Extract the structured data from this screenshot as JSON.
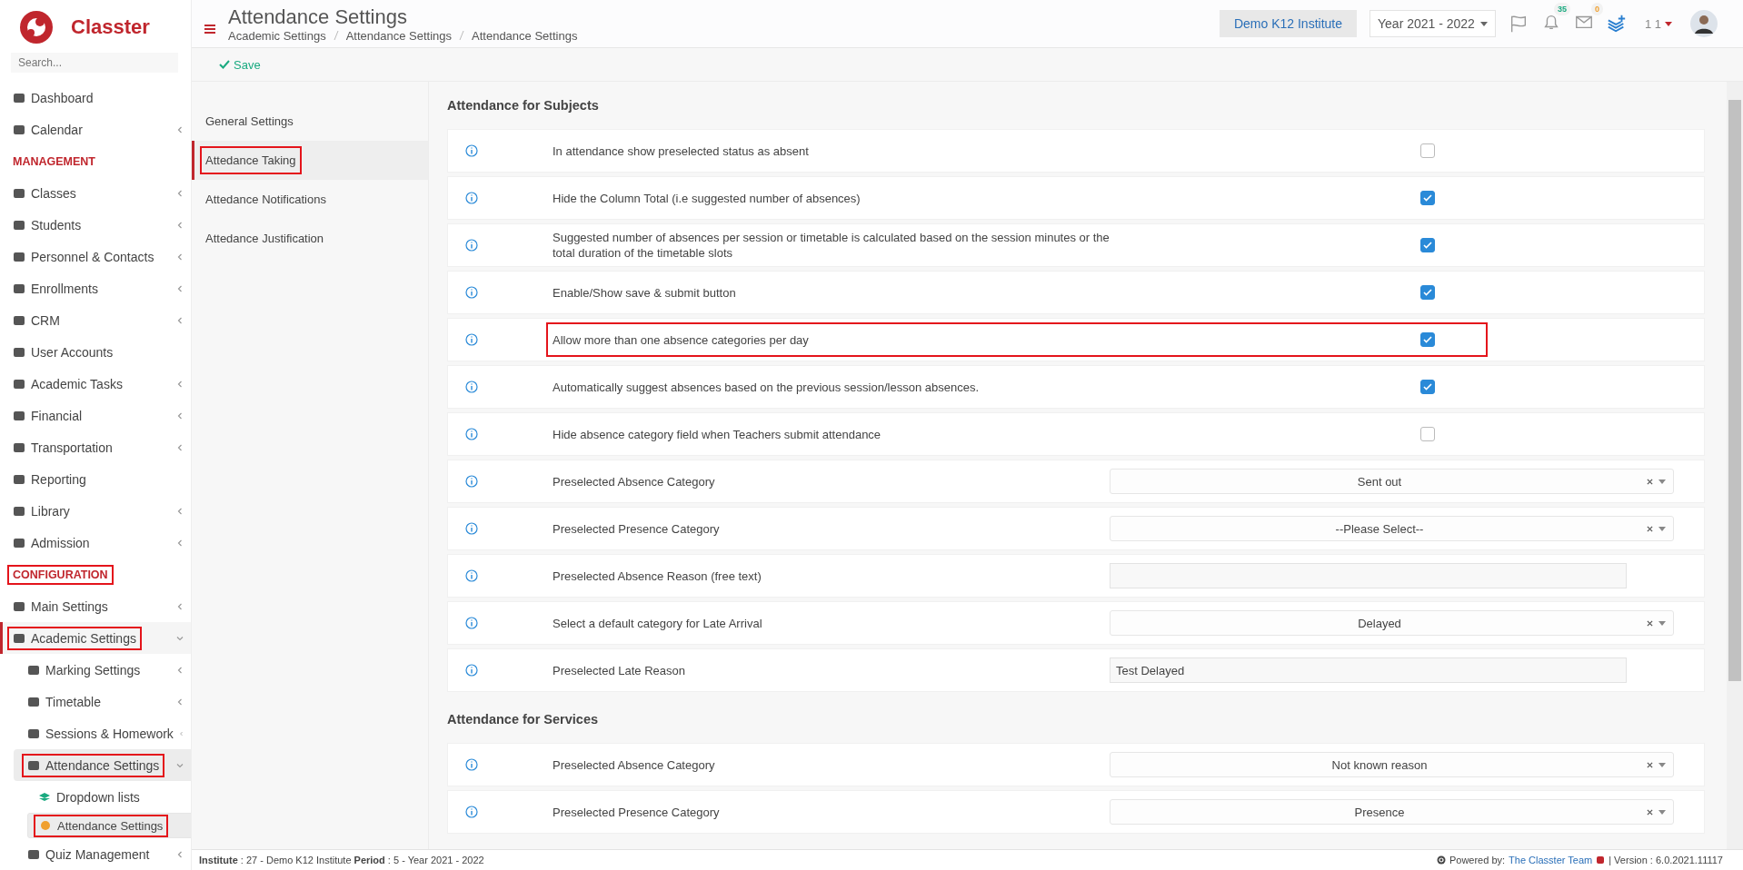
{
  "sidebar": {
    "brand": "Classter",
    "search_placeholder": "Search...",
    "items": [
      {
        "kind": "item",
        "label": "Dashboard",
        "has_children": false,
        "expanded": false,
        "selected": false,
        "highlighted": false
      },
      {
        "kind": "item",
        "label": "Calendar",
        "has_children": true,
        "expanded": false,
        "selected": false,
        "highlighted": false
      },
      {
        "kind": "heading",
        "label": "MANAGEMENT",
        "highlighted": false
      },
      {
        "kind": "item",
        "label": "Classes",
        "has_children": true,
        "expanded": false,
        "selected": false,
        "highlighted": false
      },
      {
        "kind": "item",
        "label": "Students",
        "has_children": true,
        "expanded": false,
        "selected": false,
        "highlighted": false
      },
      {
        "kind": "item",
        "label": "Personnel & Contacts",
        "has_children": true,
        "expanded": false,
        "selected": false,
        "highlighted": false
      },
      {
        "kind": "item",
        "label": "Enrollments",
        "has_children": true,
        "expanded": false,
        "selected": false,
        "highlighted": false
      },
      {
        "kind": "item",
        "label": "CRM",
        "has_children": true,
        "expanded": false,
        "selected": false,
        "highlighted": false
      },
      {
        "kind": "item",
        "label": "User Accounts",
        "has_children": false,
        "expanded": false,
        "selected": false,
        "highlighted": false
      },
      {
        "kind": "item",
        "label": "Academic Tasks",
        "has_children": true,
        "expanded": false,
        "selected": false,
        "highlighted": false
      },
      {
        "kind": "item",
        "label": "Financial",
        "has_children": true,
        "expanded": false,
        "selected": false,
        "highlighted": false
      },
      {
        "kind": "item",
        "label": "Transportation",
        "has_children": true,
        "expanded": false,
        "selected": false,
        "highlighted": false
      },
      {
        "kind": "item",
        "label": "Reporting",
        "has_children": false,
        "expanded": false,
        "selected": false,
        "highlighted": false
      },
      {
        "kind": "item",
        "label": "Library",
        "has_children": true,
        "expanded": false,
        "selected": false,
        "highlighted": false
      },
      {
        "kind": "item",
        "label": "Admission",
        "has_children": true,
        "expanded": false,
        "selected": false,
        "highlighted": false
      },
      {
        "kind": "heading",
        "label": "CONFIGURATION",
        "highlighted": true
      },
      {
        "kind": "item",
        "label": "Main Settings",
        "has_children": true,
        "expanded": false,
        "selected": false,
        "highlighted": false
      },
      {
        "kind": "item",
        "label": "Academic Settings",
        "has_children": true,
        "expanded": true,
        "selected": false,
        "highlighted": true,
        "children": [
          {
            "kind": "item",
            "label": "Marking Settings",
            "has_children": true,
            "expanded": false,
            "selected": false,
            "highlighted": false
          },
          {
            "kind": "item",
            "label": "Timetable",
            "has_children": true,
            "expanded": false,
            "selected": false,
            "highlighted": false
          },
          {
            "kind": "item",
            "label": "Sessions & Homework",
            "has_children": true,
            "expanded": false,
            "selected": false,
            "highlighted": false
          },
          {
            "kind": "item",
            "label": "Attendance Settings",
            "has_children": true,
            "expanded": true,
            "selected": false,
            "highlighted": true,
            "children": [
              {
                "kind": "item",
                "label": "Dropdown lists",
                "has_children": false,
                "expanded": false,
                "selected": false,
                "highlighted": false
              },
              {
                "kind": "item",
                "label": "Attendance Settings",
                "has_children": false,
                "expanded": false,
                "selected": true,
                "highlighted": true
              }
            ]
          },
          {
            "kind": "item",
            "label": "Quiz Management",
            "has_children": true,
            "expanded": false,
            "selected": false,
            "highlighted": false
          }
        ]
      }
    ]
  },
  "header": {
    "title": "Attendance Settings",
    "breadcrumbs": [
      "Academic Settings",
      "Attendance Settings",
      "Attendance Settings"
    ],
    "institute": "Demo K12 Institute",
    "year": "Year 2021 - 2022",
    "notifications": "35",
    "messages": "0",
    "user": "1 1"
  },
  "toolbar": {
    "save": "Save"
  },
  "submenu": [
    {
      "label": "General Settings",
      "selected": false,
      "highlighted": false
    },
    {
      "label": "Attedance Taking",
      "selected": true,
      "highlighted": true
    },
    {
      "label": "Attedance Notifications",
      "selected": false,
      "highlighted": false
    },
    {
      "label": "Attedance Justification",
      "selected": false,
      "highlighted": false
    }
  ],
  "sections": [
    {
      "title": "Attendance for Subjects",
      "rows": [
        {
          "kind": "checkbox",
          "label": "In attendance show preselected status as absent",
          "checked": false,
          "highlighted": false
        },
        {
          "kind": "checkbox",
          "label": "Hide the Column Total (i.e suggested number of absences)",
          "checked": true,
          "highlighted": false
        },
        {
          "kind": "checkbox",
          "label": "Suggested number of absences per session or timetable is calculated based on the session minutes or the total duration of the timetable slots",
          "checked": true,
          "highlighted": false
        },
        {
          "kind": "checkbox",
          "label": "Enable/Show save & submit button",
          "checked": true,
          "highlighted": false
        },
        {
          "kind": "checkbox",
          "label": "Allow more than one absence categories per day",
          "checked": true,
          "highlighted": true
        },
        {
          "kind": "checkbox",
          "label": "Automatically suggest absences based on the previous session/lesson absences.",
          "checked": true,
          "highlighted": false
        },
        {
          "kind": "checkbox",
          "label": "Hide absence category field when Teachers submit attendance",
          "checked": false,
          "highlighted": false
        },
        {
          "kind": "select",
          "label": "Preselected Absence Category",
          "value": "Sent out"
        },
        {
          "kind": "select",
          "label": "Preselected Presence Category",
          "value": "--Please Select--"
        },
        {
          "kind": "text",
          "label": "Preselected Absence Reason (free text)"
        },
        {
          "kind": "select",
          "label": "Select a default category for Late Arrival",
          "value": "Delayed"
        },
        {
          "kind": "text",
          "label": "Preselected Late Reason",
          "value": "Test Delayed"
        }
      ]
    },
    {
      "title": "Attendance for Services",
      "rows": [
        {
          "kind": "select",
          "label": "Preselected Absence Category",
          "value": "Not known reason"
        },
        {
          "kind": "select",
          "label": "Preselected Presence Category",
          "value": "Presence"
        }
      ]
    }
  ],
  "footer": {
    "info": "**Institute** : 27 - Demo K12 Institute **Period** : 5 - Year 2021 - 2022",
    "powered": "Powered by:",
    "team": "The Classter Team",
    "version": "| Version : 6.0.2021.11117"
  }
}
